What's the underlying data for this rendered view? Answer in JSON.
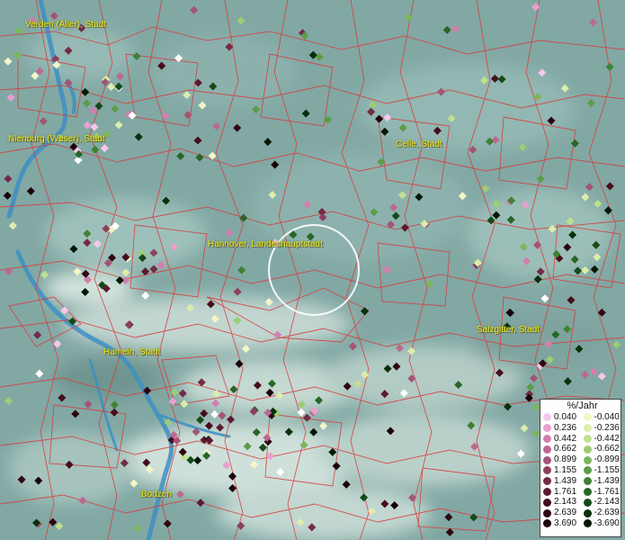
{
  "places": [
    {
      "name": "Verden (Aller), Stadt"
    },
    {
      "name": "Nienburg (Weser), Stadt"
    },
    {
      "name": "Celle, Stadt"
    },
    {
      "name": "Hannover, Landeshauptstadt"
    },
    {
      "name": "Salzgitter, Stadt"
    },
    {
      "name": "Hameln, Stadt"
    },
    {
      "name": "Bodzen"
    }
  ],
  "legend": {
    "title": "%/Jahr",
    "positive": [
      {
        "label": "0.040",
        "color": "#f6c7ec"
      },
      {
        "label": "0.236",
        "color": "#e7a0cf"
      },
      {
        "label": "0.442",
        "color": "#d27fae"
      },
      {
        "label": "0.662",
        "color": "#bd6891"
      },
      {
        "label": "0.899",
        "color": "#a35477"
      },
      {
        "label": "1.155",
        "color": "#8c405e"
      },
      {
        "label": "1.439",
        "color": "#732b45"
      },
      {
        "label": "1.761",
        "color": "#5c1a30"
      },
      {
        "label": "2.143",
        "color": "#460d1d"
      },
      {
        "label": "2.639",
        "color": "#2e0510"
      },
      {
        "label": "3.690",
        "color": "#190107"
      }
    ],
    "negative": [
      {
        "label": "-0.040",
        "color": "#f3f6c7"
      },
      {
        "label": "-0.236",
        "color": "#dcedaa"
      },
      {
        "label": "-0.442",
        "color": "#bfe08d"
      },
      {
        "label": "-0.662",
        "color": "#9ccd73"
      },
      {
        "label": "-0.899",
        "color": "#7bb65d"
      },
      {
        "label": "-1.155",
        "color": "#5b9d48"
      },
      {
        "label": "-1.439",
        "color": "#3f8236"
      },
      {
        "label": "-1.761",
        "color": "#286626"
      },
      {
        "label": "-2.143",
        "color": "#154a18"
      },
      {
        "label": "-2.639",
        "color": "#08300c"
      },
      {
        "label": "-3.690",
        "color": "#021804"
      }
    ]
  },
  "colors": {
    "terrain": "#82a8a4",
    "boundary": "#d63c3c",
    "river": "#3d90c4",
    "highlight_circle": "#ffffff"
  }
}
